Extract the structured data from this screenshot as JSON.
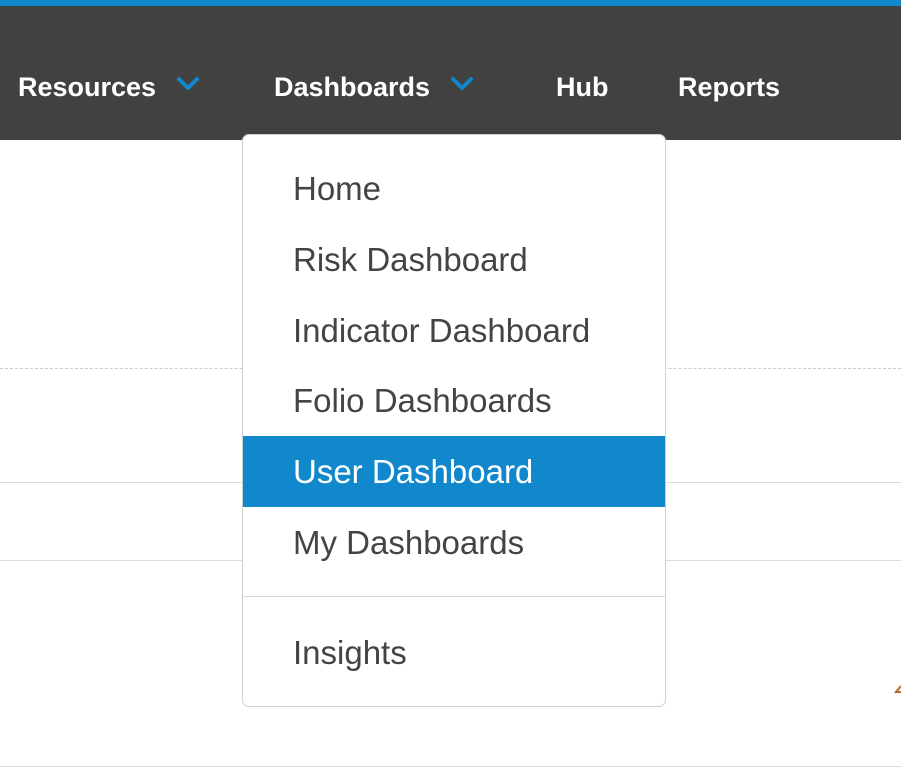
{
  "colors": {
    "accent": "#1188cc",
    "navbar_background": "#414141",
    "nav_text": "#ffffff",
    "menu_text": "#444444",
    "active_item_background": "#1188cc"
  },
  "nav": {
    "items": [
      {
        "label": "Resources",
        "has_dropdown": true,
        "icon": "chevron-down-icon"
      },
      {
        "label": "Dashboards",
        "has_dropdown": true,
        "icon": "chevron-down-icon",
        "expanded": true
      },
      {
        "label": "Hub",
        "has_dropdown": false
      },
      {
        "label": "Reports",
        "has_dropdown": false
      }
    ]
  },
  "dashboards_menu": {
    "items": [
      {
        "label": "Home"
      },
      {
        "label": "Risk Dashboard"
      },
      {
        "label": "Indicator Dashboard"
      },
      {
        "label": "Folio Dashboards"
      },
      {
        "label": "User Dashboard",
        "active": true
      },
      {
        "label": "My Dashboards"
      }
    ],
    "secondary_items": [
      {
        "label": "Insights"
      }
    ]
  }
}
